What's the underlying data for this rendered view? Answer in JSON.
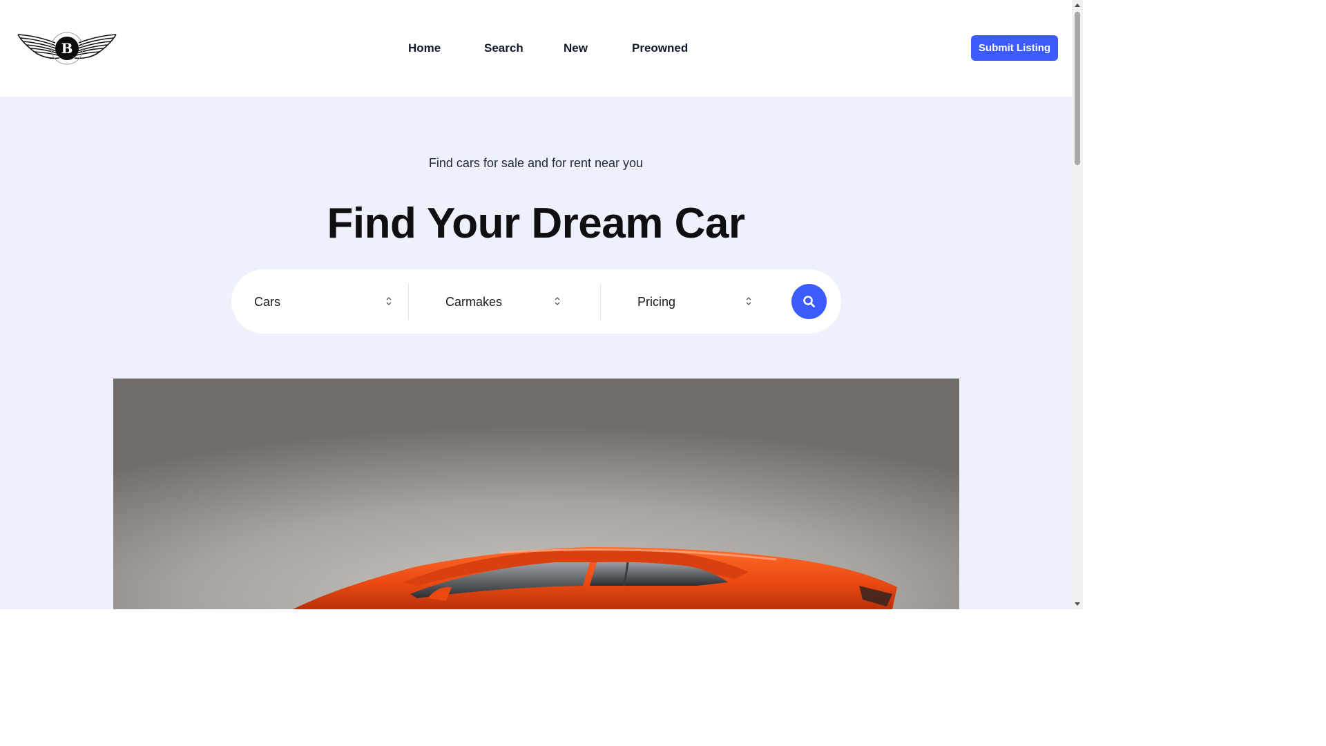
{
  "nav": {
    "items": [
      {
        "label": "Home"
      },
      {
        "label": "Search"
      },
      {
        "label": "New"
      },
      {
        "label": "Preowned"
      }
    ],
    "submit_label": "Submit Listing"
  },
  "hero": {
    "subtitle": "Find cars for sale and for rent near you",
    "title": "Find Your Dream Car"
  },
  "search": {
    "filters": [
      {
        "selected": "Cars"
      },
      {
        "selected": "Carmakes"
      },
      {
        "selected": "Pricing"
      }
    ],
    "button_icon": "search-icon"
  },
  "logo": {
    "letter": "B"
  },
  "colors": {
    "accent": "#3b5bfd",
    "hero_background": "#eef0fb",
    "car_orange": "#f0551a"
  }
}
